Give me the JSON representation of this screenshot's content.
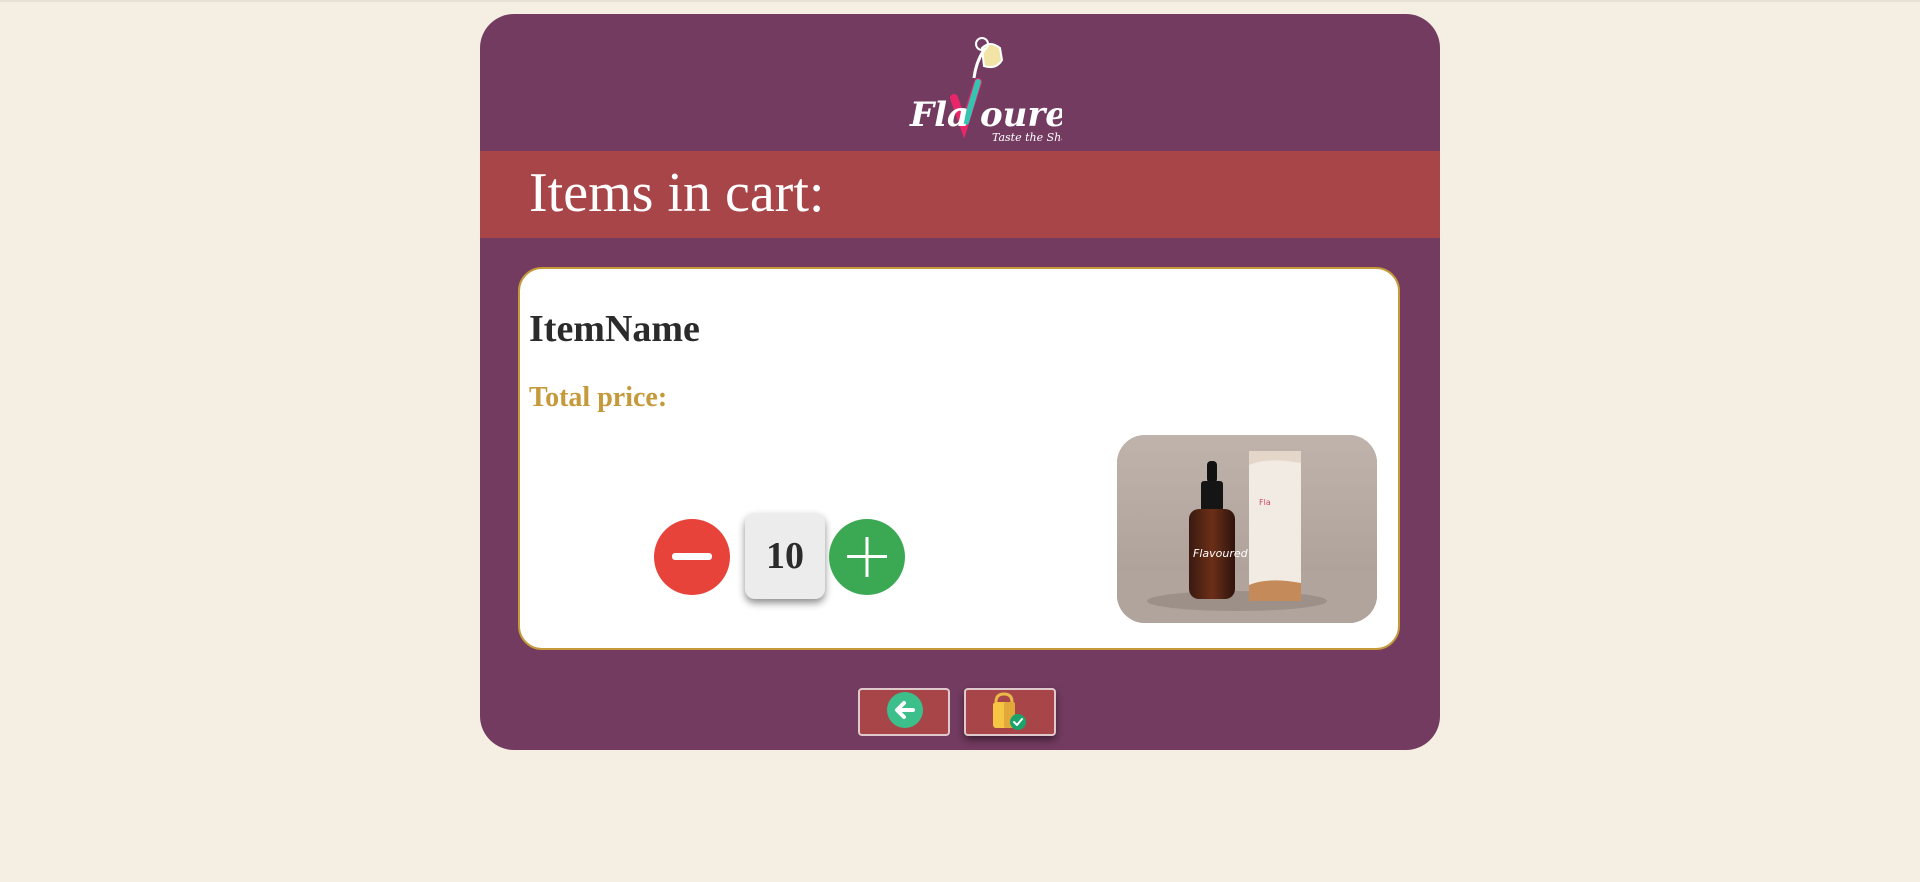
{
  "brand": {
    "name": "FlaVoured",
    "tagline": "Taste the Shades"
  },
  "cart": {
    "heading": "Items in cart:",
    "item": {
      "name": "ItemName",
      "price_label": "Total price:",
      "quantity": "10",
      "image_icon": "product-photo"
    },
    "controls": {
      "decrease_icon": "minus-icon",
      "increase_icon": "plus-icon"
    }
  },
  "actions": {
    "back_icon": "arrow-left-icon",
    "checkout_icon": "shopping-bag-check-icon"
  },
  "colors": {
    "page_background": "#f5eee3",
    "panel": "#733b60",
    "header_band": "#a84548",
    "price": "#c49a3a",
    "decrease": "#e8433b",
    "increase": "#3ba954"
  }
}
